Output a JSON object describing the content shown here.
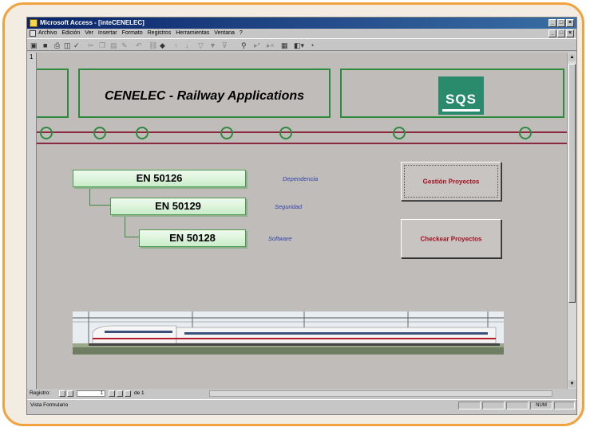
{
  "window": {
    "title": "Microsoft Access - [inteCENELEC]",
    "buttons": {
      "minimize": "_",
      "maximize": "□",
      "close": "×"
    }
  },
  "menu": {
    "items": [
      "Archivo",
      "Edición",
      "Ver",
      "Insertar",
      "Formato",
      "Registros",
      "Herramientas",
      "Ventana",
      "?"
    ]
  },
  "form": {
    "title": "CENELEC - Railway Applications",
    "logo_text": "SQS",
    "standards": [
      {
        "code": "EN 50126",
        "desc": "Dependencia"
      },
      {
        "code": "EN 50129",
        "desc": "Seguridad"
      },
      {
        "code": "EN 50128",
        "desc": "Software"
      }
    ],
    "buttons": {
      "gestion": "Gestión Proyectos",
      "checkear": "Checkear Proyectos"
    },
    "colors": {
      "accent_green": "#2e8b3e",
      "track_red": "#8b2a3e",
      "button_text": "#a01020"
    }
  },
  "ruler": {
    "mark": "1"
  },
  "nav": {
    "label": "Registro:",
    "record": "1",
    "total": "de 1"
  },
  "status": {
    "text": "Vista Formulario",
    "indicator": "NUM"
  }
}
